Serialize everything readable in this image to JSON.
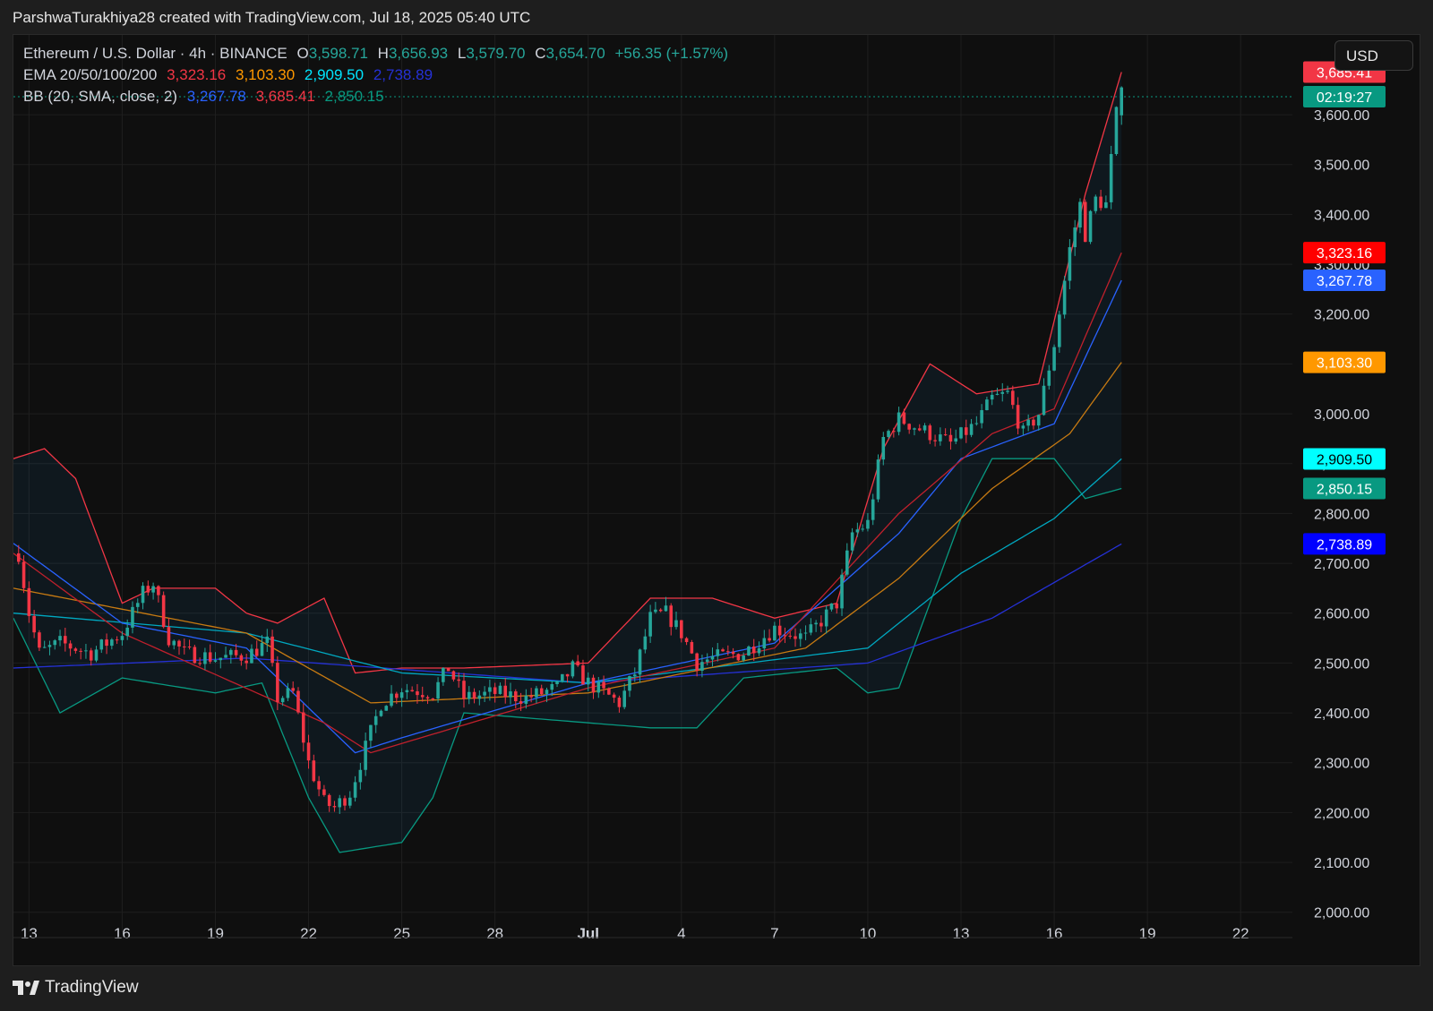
{
  "caption": "ParshwaTurakhiya28 created with TradingView.com, Jul 18, 2025 05:40 UTC",
  "legend": {
    "symbol": "Ethereum / U.S. Dollar · 4h · BINANCE",
    "open_label": "O",
    "open": "3,598.71",
    "high_label": "H",
    "high": "3,656.93",
    "low_label": "L",
    "low": "3,579.70",
    "close_label": "C",
    "close": "3,654.70",
    "change": "+56.35 (+1.57%)",
    "ema_label": "EMA 20/50/100/200",
    "ema20": "3,323.16",
    "ema50": "3,103.30",
    "ema100": "2,909.50",
    "ema200": "2,738.89",
    "bb_label": "BB (20, SMA, close, 2)",
    "bb_basis": "3,267.78",
    "bb_upper": "3,685.41",
    "bb_lower": "2,850.15"
  },
  "currency": "USD",
  "footer": {
    "brand": "TradingView"
  },
  "colors": {
    "up": "#26a69a",
    "down": "#f23645",
    "ema20": "#f23645",
    "ema50": "#ff9800",
    "ema100": "#00e5ff",
    "ema200": "#2962ff",
    "bb_basis": "#2962ff",
    "bb_upper": "#f23645",
    "bb_lower": "#089981",
    "countdown": "#089981"
  },
  "chart_data": {
    "type": "candlestick",
    "timeframe": "4h",
    "ylim": [
      1960,
      3760
    ],
    "y_ticks": [
      2000,
      2100,
      2200,
      2300,
      2400,
      2500,
      2600,
      2700,
      2800,
      2900,
      3000,
      3100,
      3200,
      3300,
      3400,
      3500,
      3600
    ],
    "y_tick_labels": [
      "2,000.00",
      "2,100.00",
      "2,200.00",
      "2,300.00",
      "2,400.00",
      "2,500.00",
      "2,600.00",
      "2,700.00",
      "2,800.00",
      "2,900.00",
      "3,000.00",
      "3,100.00",
      "3,200.00",
      "3,300.00",
      "3,400.00",
      "3,500.00",
      "3,600.00"
    ],
    "x_ticks": [
      "2025-06-13",
      "2025-06-16",
      "2025-06-19",
      "2025-06-22",
      "2025-06-25",
      "2025-06-28",
      "2025-07-01",
      "2025-07-04",
      "2025-07-07",
      "2025-07-10",
      "2025-07-13",
      "2025-07-16",
      "2025-07-19",
      "2025-07-22"
    ],
    "x_tick_labels": [
      "13",
      "16",
      "19",
      "22",
      "25",
      "28",
      "Jul",
      "4",
      "7",
      "10",
      "13",
      "16",
      "19",
      "22"
    ],
    "x_range": [
      "2025-06-12T12:00",
      "2025-07-23T16:00"
    ],
    "price_markers": [
      {
        "label": "3,685.41",
        "value": 3685.41,
        "color": "#f23645"
      },
      {
        "label": "02:19:27",
        "value": 3636,
        "color": "#089981"
      },
      {
        "label": "3,323.16",
        "value": 3323.16,
        "color": "#ff0000"
      },
      {
        "label": "3,267.78",
        "value": 3267.78,
        "color": "#2962ff"
      },
      {
        "label": "3,103.30",
        "value": 3103.3,
        "color": "#ff9800"
      },
      {
        "label": "2,909.50",
        "value": 2909.5,
        "color": "#00ffff"
      },
      {
        "label": "2,850.15",
        "value": 2850.15,
        "color": "#089981"
      },
      {
        "label": "2,738.89",
        "value": 2738.89,
        "color": "#0000ff"
      }
    ],
    "last_price": 3654.7,
    "price_anchors": [
      [
        "2025-06-12T16:00",
        2720
      ],
      [
        "2025-06-13T00:00",
        2600
      ],
      [
        "2025-06-13T08:00",
        2520
      ],
      [
        "2025-06-14T00:00",
        2540
      ],
      [
        "2025-06-15T00:00",
        2520
      ],
      [
        "2025-06-16T00:00",
        2560
      ],
      [
        "2025-06-16T16:00",
        2640
      ],
      [
        "2025-06-17T00:00",
        2660
      ],
      [
        "2025-06-17T12:00",
        2550
      ],
      [
        "2025-06-18T00:00",
        2520
      ],
      [
        "2025-06-19T00:00",
        2510
      ],
      [
        "2025-06-20T00:00",
        2515
      ],
      [
        "2025-06-20T16:00",
        2540
      ],
      [
        "2025-06-21T00:00",
        2430
      ],
      [
        "2025-06-21T12:00",
        2440
      ],
      [
        "2025-06-22T00:00",
        2300
      ],
      [
        "2025-06-22T12:00",
        2220
      ],
      [
        "2025-06-22T20:00",
        2210
      ],
      [
        "2025-06-23T08:00",
        2240
      ],
      [
        "2025-06-23T20:00",
        2330
      ],
      [
        "2025-06-24T08:00",
        2420
      ],
      [
        "2025-06-25T00:00",
        2450
      ],
      [
        "2025-06-26T00:00",
        2440
      ],
      [
        "2025-06-26T12:00",
        2490
      ],
      [
        "2025-06-27T00:00",
        2430
      ],
      [
        "2025-06-28T00:00",
        2440
      ],
      [
        "2025-06-29T00:00",
        2430
      ],
      [
        "2025-06-30T00:00",
        2450
      ],
      [
        "2025-06-30T12:00",
        2490
      ],
      [
        "2025-07-01T00:00",
        2460
      ],
      [
        "2025-07-02T00:00",
        2420
      ],
      [
        "2025-07-02T12:00",
        2480
      ],
      [
        "2025-07-03T00:00",
        2590
      ],
      [
        "2025-07-03T12:00",
        2600
      ],
      [
        "2025-07-04T00:00",
        2560
      ],
      [
        "2025-07-04T12:00",
        2500
      ],
      [
        "2025-07-05T00:00",
        2510
      ],
      [
        "2025-07-06T00:00",
        2520
      ],
      [
        "2025-07-07T00:00",
        2570
      ],
      [
        "2025-07-08T00:00",
        2550
      ],
      [
        "2025-07-09T00:00",
        2620
      ],
      [
        "2025-07-09T12:00",
        2760
      ],
      [
        "2025-07-10T00:00",
        2780
      ],
      [
        "2025-07-10T12:00",
        2950
      ],
      [
        "2025-07-11T00:00",
        2990
      ],
      [
        "2025-07-12T00:00",
        2960
      ],
      [
        "2025-07-12T16:00",
        2940
      ],
      [
        "2025-07-13T12:00",
        2980
      ],
      [
        "2025-07-14T00:00",
        3030
      ],
      [
        "2025-07-14T12:00",
        3040
      ],
      [
        "2025-07-15T00:00",
        2960
      ],
      [
        "2025-07-15T12:00",
        3000
      ],
      [
        "2025-07-16T00:00",
        3140
      ],
      [
        "2025-07-16T12:00",
        3330
      ],
      [
        "2025-07-16T20:00",
        3420
      ],
      [
        "2025-07-17T00:00",
        3360
      ],
      [
        "2025-07-17T08:00",
        3430
      ],
      [
        "2025-07-17T16:00",
        3420
      ],
      [
        "2025-07-18T00:00",
        3600
      ],
      [
        "2025-07-18T04:00",
        3654.7
      ]
    ],
    "ema200_anchors": [
      [
        "2025-06-12T12:00",
        2490
      ],
      [
        "2025-06-20T00:00",
        2510
      ],
      [
        "2025-07-01T00:00",
        2460
      ],
      [
        "2025-07-10T00:00",
        2500
      ],
      [
        "2025-07-14T00:00",
        2590
      ],
      [
        "2025-07-18T04:00",
        2738.89
      ]
    ],
    "ema100_anchors": [
      [
        "2025-06-12T12:00",
        2600
      ],
      [
        "2025-06-20T00:00",
        2560
      ],
      [
        "2025-06-25T00:00",
        2480
      ],
      [
        "2025-07-01T00:00",
        2460
      ],
      [
        "2025-07-10T00:00",
        2530
      ],
      [
        "2025-07-13T00:00",
        2680
      ],
      [
        "2025-07-16T00:00",
        2790
      ],
      [
        "2025-07-18T04:00",
        2909.5
      ]
    ],
    "ema50_anchors": [
      [
        "2025-06-12T12:00",
        2650
      ],
      [
        "2025-06-20T00:00",
        2560
      ],
      [
        "2025-06-24T00:00",
        2420
      ],
      [
        "2025-07-01T00:00",
        2440
      ],
      [
        "2025-07-08T00:00",
        2530
      ],
      [
        "2025-07-11T00:00",
        2670
      ],
      [
        "2025-07-14T00:00",
        2850
      ],
      [
        "2025-07-16T12:00",
        2960
      ],
      [
        "2025-07-18T04:00",
        3103.3
      ]
    ],
    "ema20_anchors": [
      [
        "2025-06-12T12:00",
        2720
      ],
      [
        "2025-06-16T00:00",
        2560
      ],
      [
        "2025-06-22T12:00",
        2380
      ],
      [
        "2025-06-24T00:00",
        2320
      ],
      [
        "2025-07-01T00:00",
        2450
      ],
      [
        "2025-07-07T00:00",
        2530
      ],
      [
        "2025-07-11T00:00",
        2800
      ],
      [
        "2025-07-14T00:00",
        2960
      ],
      [
        "2025-07-16T00:00",
        3010
      ],
      [
        "2025-07-18T04:00",
        3323.16
      ]
    ],
    "bb_basis_anchors": [
      [
        "2025-06-12T12:00",
        2740
      ],
      [
        "2025-06-16T00:00",
        2580
      ],
      [
        "2025-06-20T00:00",
        2530
      ],
      [
        "2025-06-23T12:00",
        2320
      ],
      [
        "2025-06-25T00:00",
        2350
      ],
      [
        "2025-07-01T00:00",
        2460
      ],
      [
        "2025-07-07T00:00",
        2540
      ],
      [
        "2025-07-11T00:00",
        2760
      ],
      [
        "2025-07-13T00:00",
        2910
      ],
      [
        "2025-07-16T00:00",
        2980
      ],
      [
        "2025-07-18T04:00",
        3267.78
      ]
    ],
    "bb_upper_anchors": [
      [
        "2025-06-12T12:00",
        2910
      ],
      [
        "2025-06-13T12:00",
        2930
      ],
      [
        "2025-06-14T12:00",
        2870
      ],
      [
        "2025-06-16T00:00",
        2620
      ],
      [
        "2025-06-17T00:00",
        2650
      ],
      [
        "2025-06-19T00:00",
        2650
      ],
      [
        "2025-06-20T00:00",
        2600
      ],
      [
        "2025-06-21T00:00",
        2580
      ],
      [
        "2025-06-22T12:00",
        2630
      ],
      [
        "2025-06-23T12:00",
        2480
      ],
      [
        "2025-06-25T00:00",
        2490
      ],
      [
        "2025-06-27T00:00",
        2490
      ],
      [
        "2025-07-01T00:00",
        2500
      ],
      [
        "2025-07-03T00:00",
        2630
      ],
      [
        "2025-07-05T00:00",
        2630
      ],
      [
        "2025-07-07T00:00",
        2590
      ],
      [
        "2025-07-09T00:00",
        2620
      ],
      [
        "2025-07-10T12:00",
        2930
      ],
      [
        "2025-07-12T00:00",
        3100
      ],
      [
        "2025-07-13T12:00",
        3040
      ],
      [
        "2025-07-15T12:00",
        3060
      ],
      [
        "2025-07-17T00:00",
        3440
      ],
      [
        "2025-07-18T04:00",
        3685.41
      ]
    ],
    "bb_lower_anchors": [
      [
        "2025-06-12T12:00",
        2590
      ],
      [
        "2025-06-14T00:00",
        2400
      ],
      [
        "2025-06-16T00:00",
        2470
      ],
      [
        "2025-06-19T00:00",
        2440
      ],
      [
        "2025-06-20T12:00",
        2460
      ],
      [
        "2025-06-22T00:00",
        2230
      ],
      [
        "2025-06-23T00:00",
        2120
      ],
      [
        "2025-06-25T00:00",
        2140
      ],
      [
        "2025-06-26T00:00",
        2230
      ],
      [
        "2025-06-27T00:00",
        2400
      ],
      [
        "2025-07-01T00:00",
        2380
      ],
      [
        "2025-07-03T00:00",
        2370
      ],
      [
        "2025-07-04T12:00",
        2370
      ],
      [
        "2025-07-06T00:00",
        2470
      ],
      [
        "2025-07-09T00:00",
        2490
      ],
      [
        "2025-07-10T00:00",
        2440
      ],
      [
        "2025-07-11T00:00",
        2450
      ],
      [
        "2025-07-12T00:00",
        2620
      ],
      [
        "2025-07-13T00:00",
        2790
      ],
      [
        "2025-07-14T00:00",
        2910
      ],
      [
        "2025-07-16T00:00",
        2910
      ],
      [
        "2025-07-17T00:00",
        2830
      ],
      [
        "2025-07-18T04:00",
        2850.15
      ]
    ]
  }
}
